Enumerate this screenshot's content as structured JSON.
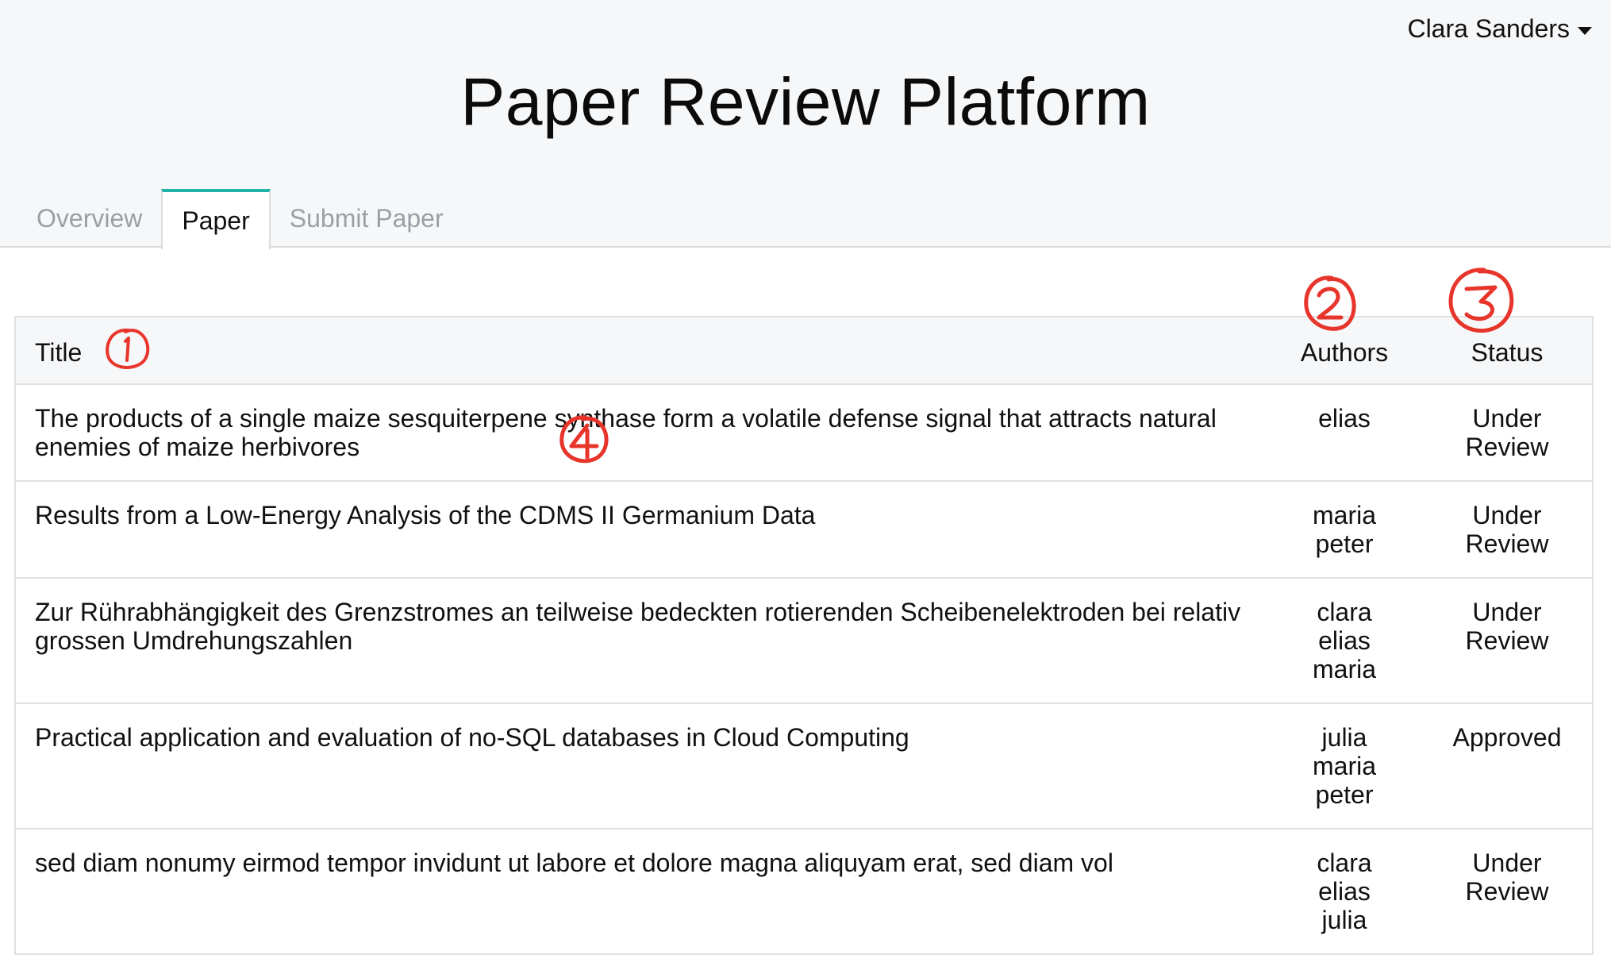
{
  "app": {
    "title": "Paper Review Platform",
    "user_name": "Clara Sanders"
  },
  "tabs": [
    {
      "label": "Overview",
      "active": false
    },
    {
      "label": "Paper",
      "active": true
    },
    {
      "label": "Submit Paper",
      "active": false
    }
  ],
  "table": {
    "columns": {
      "title": "Title",
      "authors": "Authors",
      "status": "Status"
    },
    "rows": [
      {
        "title": "The products of a single maize sesquiterpene synthase form a volatile defense signal that attracts natural enemies of maize herbivores",
        "authors": [
          "elias"
        ],
        "status": "Under Review"
      },
      {
        "title": "Results from a Low-Energy Analysis of the CDMS II Germanium Data",
        "authors": [
          "maria",
          "peter"
        ],
        "status": "Under Review"
      },
      {
        "title": "Zur Rührabhängigkeit des Grenzstromes an teilweise bedeckten rotierenden Scheibenelektroden bei relativ grossen Umdrehungszahlen",
        "authors": [
          "clara",
          "elias",
          "maria"
        ],
        "status": "Under Review"
      },
      {
        "title": "Practical application and evaluation of no-SQL databases in Cloud Computing",
        "authors": [
          "julia",
          "maria",
          "peter"
        ],
        "status": "Approved"
      },
      {
        "title": "sed diam nonumy eirmod tempor invidunt ut labore et dolore magna aliquyam erat, sed diam vol",
        "authors": [
          "clara",
          "elias",
          "julia"
        ],
        "status": "Under Review"
      }
    ]
  },
  "annotations": {
    "color": "#e8352b",
    "marks": [
      "1",
      "2",
      "3",
      "4"
    ]
  },
  "colors": {
    "accent": "#21b1a6",
    "header_bg": "#f6f7f9"
  }
}
